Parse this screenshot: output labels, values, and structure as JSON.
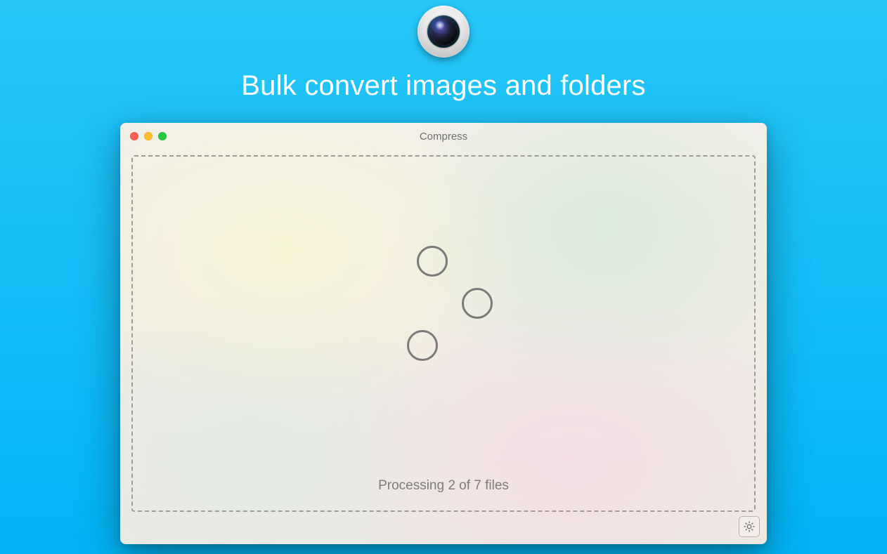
{
  "page": {
    "headline": "Bulk convert images and folders"
  },
  "window": {
    "title": "Compress",
    "status_text": "Processing 2 of 7 files"
  }
}
